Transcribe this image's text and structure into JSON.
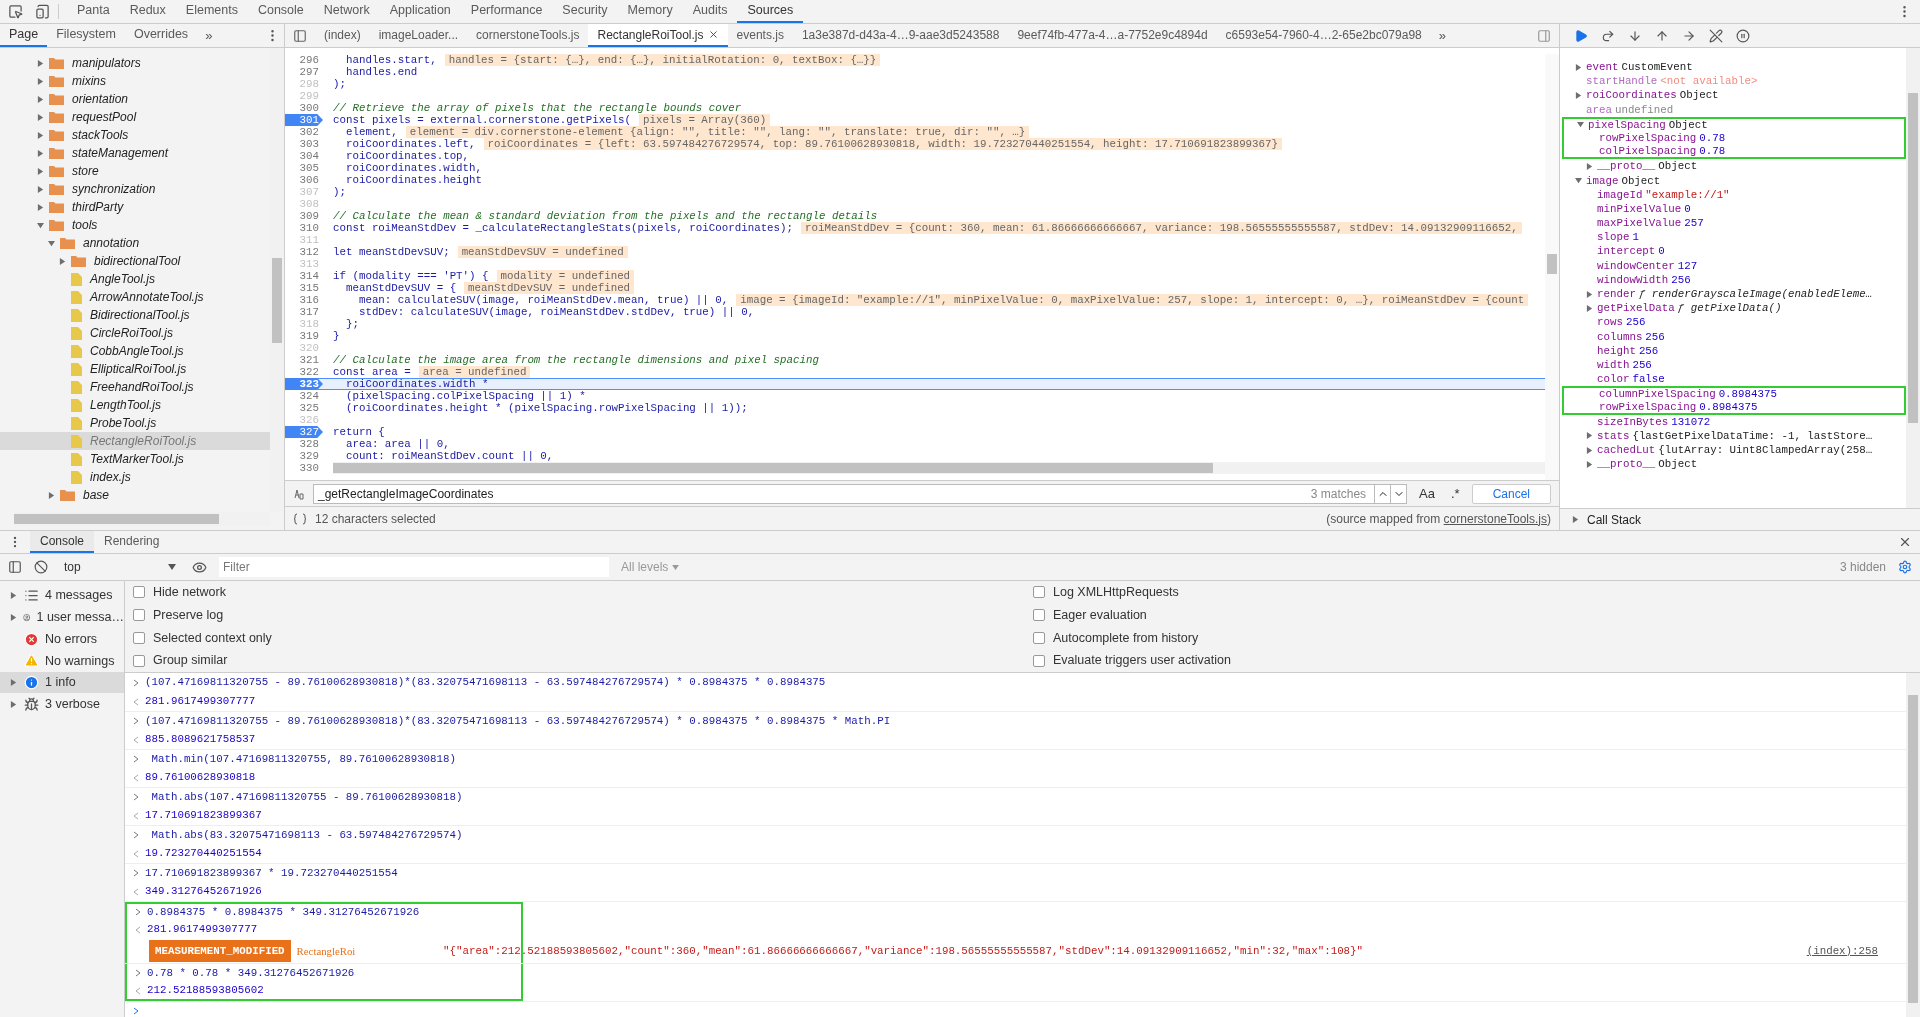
{
  "top_tabs": [
    {
      "label": "Panta",
      "selected": false
    },
    {
      "label": "Redux",
      "selected": false
    },
    {
      "label": "Elements",
      "selected": false
    },
    {
      "label": "Console",
      "selected": false
    },
    {
      "label": "Network",
      "selected": false
    },
    {
      "label": "Application",
      "selected": false
    },
    {
      "label": "Performance",
      "selected": false
    },
    {
      "label": "Security",
      "selected": false
    },
    {
      "label": "Memory",
      "selected": false
    },
    {
      "label": "Audits",
      "selected": false
    },
    {
      "label": "Sources",
      "selected": true
    }
  ],
  "navigator": {
    "tabs": [
      {
        "label": "Page",
        "selected": true
      },
      {
        "label": "Filesystem",
        "selected": false
      },
      {
        "label": "Overrides",
        "selected": false
      }
    ],
    "more": "»",
    "tree": [
      {
        "name": "manipulators",
        "kind": "folder",
        "expanded": false,
        "selected": false
      },
      {
        "name": "mixins",
        "kind": "folder",
        "expanded": false,
        "selected": false
      },
      {
        "name": "orientation",
        "kind": "folder",
        "expanded": false,
        "selected": false
      },
      {
        "name": "requestPool",
        "kind": "folder",
        "expanded": false,
        "selected": false
      },
      {
        "name": "stackTools",
        "kind": "folder",
        "expanded": false,
        "selected": false
      },
      {
        "name": "stateManagement",
        "kind": "folder",
        "expanded": false,
        "selected": false
      },
      {
        "name": "store",
        "kind": "folder",
        "expanded": false,
        "selected": false
      },
      {
        "name": "synchronization",
        "kind": "folder",
        "expanded": false,
        "selected": false
      },
      {
        "name": "thirdParty",
        "kind": "folder",
        "expanded": false,
        "selected": false
      },
      {
        "name": "tools",
        "kind": "folder",
        "expanded": true,
        "selected": false,
        "children": [
          {
            "name": "annotation",
            "kind": "folder",
            "expanded": true,
            "selected": false,
            "children": [
              {
                "name": "bidirectionalTool",
                "kind": "folder",
                "expanded": false,
                "selected": false
              },
              {
                "name": "AngleTool.js",
                "kind": "file",
                "selected": false
              },
              {
                "name": "ArrowAnnotateTool.js",
                "kind": "file",
                "selected": false
              },
              {
                "name": "BidirectionalTool.js",
                "kind": "file",
                "selected": false
              },
              {
                "name": "CircleRoiTool.js",
                "kind": "file",
                "selected": false
              },
              {
                "name": "CobbAngleTool.js",
                "kind": "file",
                "selected": false
              },
              {
                "name": "EllipticalRoiTool.js",
                "kind": "file",
                "selected": false
              },
              {
                "name": "FreehandRoiTool.js",
                "kind": "file",
                "selected": false
              },
              {
                "name": "LengthTool.js",
                "kind": "file",
                "selected": false
              },
              {
                "name": "ProbeTool.js",
                "kind": "file",
                "selected": false
              },
              {
                "name": "RectangleRoiTool.js",
                "kind": "file",
                "selected": true
              },
              {
                "name": "TextMarkerTool.js",
                "kind": "file",
                "selected": false
              },
              {
                "name": "index.js",
                "kind": "file",
                "selected": false
              }
            ]
          },
          {
            "name": "base",
            "kind": "folder",
            "expanded": false,
            "selected": false
          }
        ]
      }
    ]
  },
  "editor": {
    "tabs": [
      {
        "label": "(index)",
        "selected": false,
        "closable": false
      },
      {
        "label": "imageLoader...",
        "selected": false,
        "closable": false
      },
      {
        "label": "cornerstoneTools.js",
        "selected": false,
        "closable": false
      },
      {
        "label": "RectangleRoiTool.js",
        "selected": true,
        "closable": true
      },
      {
        "label": "events.js",
        "selected": false,
        "closable": false
      },
      {
        "label": "1a3e387d-d43a-4…9-aae3d5243588",
        "selected": false,
        "closable": false
      },
      {
        "label": "9eef74fb-477a-4…a-7752e9c4894d",
        "selected": false,
        "closable": false
      },
      {
        "label": "c6593e54-7960-4…2-65e2bc079a98",
        "selected": false,
        "closable": false
      }
    ],
    "more": "»",
    "lines": [
      {
        "number": "296",
        "kind": "code",
        "text": "  handles.start,",
        "inline_value": "handles = {start: {…}, end: {…}, initialRotation: 0, textBox: {…}}",
        "breakpoint": false,
        "current": false,
        "greyed": false
      },
      {
        "number": "297",
        "kind": "code",
        "text": "  handles.end",
        "breakpoint": false,
        "current": false,
        "greyed": false
      },
      {
        "number": "298",
        "kind": "code",
        "text": ");",
        "breakpoint": false,
        "current": false,
        "greyed": true
      },
      {
        "number": "299",
        "breakpoint": false,
        "current": false,
        "greyed": true
      },
      {
        "number": "300",
        "kind": "comment",
        "text": "// Retrieve the array of pixels that the rectangle bounds cover",
        "breakpoint": false,
        "current": false,
        "greyed": false
      },
      {
        "number": "301",
        "kind": "code",
        "text": "const pixels = external.cornerstone.getPixels(",
        "inline_value": "pixels = Array(360)",
        "breakpoint": true,
        "current": false,
        "greyed": false
      },
      {
        "number": "302",
        "kind": "code",
        "text": "  element,",
        "inline_value": "element = div.cornerstone-element {align: \"\", title: \"\", lang: \"\", translate: true, dir: \"\", …}",
        "breakpoint": false,
        "current": false,
        "greyed": false
      },
      {
        "number": "303",
        "kind": "code",
        "text": "  roiCoordinates.left,",
        "inline_value": "roiCoordinates = {left: 63.597484276729574, top: 89.76100628930818, width: 19.723270440251554, height: 17.710691823899367}",
        "breakpoint": false,
        "current": false,
        "greyed": false
      },
      {
        "number": "304",
        "kind": "code",
        "text": "  roiCoordinates.top,",
        "breakpoint": false,
        "current": false,
        "greyed": false
      },
      {
        "number": "305",
        "kind": "code",
        "text": "  roiCoordinates.width,",
        "breakpoint": false,
        "current": false,
        "greyed": false
      },
      {
        "number": "306",
        "kind": "code",
        "text": "  roiCoordinates.height",
        "breakpoint": false,
        "current": false,
        "greyed": false
      },
      {
        "number": "307",
        "kind": "code",
        "text": ");",
        "breakpoint": false,
        "current": false,
        "greyed": true
      },
      {
        "number": "308",
        "breakpoint": false,
        "current": false,
        "greyed": true
      },
      {
        "number": "309",
        "kind": "comment",
        "text": "// Calculate the mean & standard deviation from the pixels and the rectangle details",
        "breakpoint": false,
        "current": false,
        "greyed": false
      },
      {
        "number": "310",
        "kind": "code",
        "text": "const roiMeanStdDev = _calculateRectangleStats(pixels, roiCoordinates);",
        "inline_value": "roiMeanStdDev = {count: 360, mean: 61.86666666666667, variance: 198.56555555555587, stdDev: 14.09132909116652,",
        "breakpoint": false,
        "current": false,
        "greyed": false
      },
      {
        "number": "311",
        "breakpoint": false,
        "current": false,
        "greyed": true
      },
      {
        "number": "312",
        "kind": "code",
        "text": "let meanStdDevSUV;",
        "inline_value": "meanStdDevSUV = undefined",
        "breakpoint": false,
        "current": false,
        "greyed": false
      },
      {
        "number": "313",
        "breakpoint": false,
        "current": false,
        "greyed": true
      },
      {
        "number": "314",
        "kind": "code",
        "text": "if (modality === 'PT') {",
        "inline_value": "modality = undefined",
        "breakpoint": false,
        "current": false,
        "greyed": false
      },
      {
        "number": "315",
        "kind": "code",
        "text": "  meanStdDevSUV = {",
        "inline_value": "meanStdDevSUV = undefined",
        "breakpoint": false,
        "current": false,
        "greyed": false
      },
      {
        "number": "316",
        "kind": "code",
        "text": "    mean: calculateSUV(image, roiMeanStdDev.mean, true) || 0,",
        "inline_value": "image = {imageId: \"example://1\", minPixelValue: 0, maxPixelValue: 257, slope: 1, intercept: 0, …}, roiMeanStdDev = {count",
        "breakpoint": false,
        "current": false,
        "greyed": false
      },
      {
        "number": "317",
        "kind": "code",
        "text": "    stdDev: calculateSUV(image, roiMeanStdDev.stdDev, true) || 0,",
        "breakpoint": false,
        "current": false,
        "greyed": false
      },
      {
        "number": "318",
        "kind": "code",
        "text": "  };",
        "breakpoint": false,
        "current": false,
        "greyed": true
      },
      {
        "number": "319",
        "kind": "code",
        "text": "}",
        "breakpoint": false,
        "current": false,
        "greyed": false
      },
      {
        "number": "320",
        "breakpoint": false,
        "current": false,
        "greyed": true
      },
      {
        "number": "321",
        "kind": "comment",
        "text": "// Calculate the image area from the rectangle dimensions and pixel spacing",
        "breakpoint": false,
        "current": false,
        "greyed": false
      },
      {
        "number": "322",
        "kind": "code",
        "text": "const area =",
        "inline_value": "area = undefined",
        "breakpoint": false,
        "current": false,
        "greyed": false
      },
      {
        "number": "323",
        "kind": "code",
        "text": "  roiCoordinates.width *",
        "breakpoint": true,
        "current": true,
        "greyed": false
      },
      {
        "number": "324",
        "kind": "code",
        "text": "  (pixelSpacing.colPixelSpacing || 1) *",
        "breakpoint": false,
        "current": false,
        "greyed": false
      },
      {
        "number": "325",
        "kind": "code",
        "text": "  (roiCoordinates.height * (pixelSpacing.rowPixelSpacing || 1));",
        "breakpoint": false,
        "current": false,
        "greyed": false
      },
      {
        "number": "326",
        "breakpoint": false,
        "current": false,
        "greyed": true
      },
      {
        "number": "327",
        "kind": "code",
        "text": "return {",
        "breakpoint": true,
        "current": false,
        "greyed": false
      },
      {
        "number": "328",
        "kind": "code",
        "text": "  area: area || 0,",
        "breakpoint": false,
        "current": false,
        "greyed": false
      },
      {
        "number": "329",
        "kind": "code",
        "text": "  count: roiMeanStdDev.count || 0,",
        "breakpoint": false,
        "current": false,
        "greyed": false
      },
      {
        "number": "330",
        "breakpoint": false,
        "current": false,
        "greyed": false
      }
    ],
    "search": {
      "value": "_getRectangleImageCoordinates",
      "matches": "3 matches",
      "case_button": "Aa",
      "regex_button": ".*",
      "cancel": "Cancel"
    },
    "status": {
      "selection": "12 characters selected",
      "source_prefix": "(source mapped from ",
      "source_link": "cornerstoneTools.js",
      "source_suffix": ")"
    }
  },
  "scope": [
    {
      "key": "event",
      "value": "CustomEvent",
      "expanded": false,
      "kind": "object",
      "marked": false
    },
    {
      "key": "startHandle",
      "value": "<not available>",
      "kind": "unavailable",
      "marked": false
    },
    {
      "key": "roiCoordinates",
      "value": "Object",
      "expanded": false,
      "kind": "object",
      "marked": false
    },
    {
      "key": "area",
      "value": "undefined",
      "kind": "undefined",
      "marked": false
    },
    {
      "key": "pixelSpacing",
      "value": "Object",
      "expanded": true,
      "kind": "object",
      "marked": true,
      "children": [
        {
          "key": "rowPixelSpacing",
          "value": "0.78",
          "kind": "number",
          "marked": true
        },
        {
          "key": "colPixelSpacing",
          "value": "0.78",
          "kind": "number",
          "marked": true
        },
        {
          "key": "__proto__",
          "value": "Object",
          "expanded": false,
          "kind": "object",
          "marked": false
        }
      ]
    },
    {
      "key": "image",
      "value": "Object",
      "expanded": true,
      "kind": "object",
      "marked": false,
      "children": [
        {
          "key": "imageId",
          "value": "\"example://1\"",
          "kind": "string",
          "marked": false
        },
        {
          "key": "minPixelValue",
          "value": "0",
          "kind": "number",
          "marked": false
        },
        {
          "key": "maxPixelValue",
          "value": "257",
          "kind": "number",
          "marked": false
        },
        {
          "key": "slope",
          "value": "1",
          "kind": "number",
          "marked": false
        },
        {
          "key": "intercept",
          "value": "0",
          "kind": "number",
          "marked": false
        },
        {
          "key": "windowCenter",
          "value": "127",
          "kind": "number",
          "marked": false
        },
        {
          "key": "windowWidth",
          "value": "256",
          "kind": "number",
          "marked": false
        },
        {
          "key": "render",
          "value": "ƒ renderGrayscaleImage(enabledEleme…",
          "expanded": false,
          "kind": "function",
          "marked": false
        },
        {
          "key": "getPixelData",
          "value": "ƒ getPixelData()",
          "expanded": false,
          "kind": "function",
          "marked": false
        },
        {
          "key": "rows",
          "value": "256",
          "kind": "number",
          "marked": false
        },
        {
          "key": "columns",
          "value": "256",
          "kind": "number",
          "marked": false
        },
        {
          "key": "height",
          "value": "256",
          "kind": "number",
          "marked": false
        },
        {
          "key": "width",
          "value": "256",
          "kind": "number",
          "marked": false
        },
        {
          "key": "color",
          "value": "false",
          "kind": "number",
          "marked": false
        },
        {
          "key": "columnPixelSpacing",
          "value": "0.8984375",
          "kind": "number",
          "marked": true
        },
        {
          "key": "rowPixelSpacing",
          "value": "0.8984375",
          "kind": "number",
          "marked": true
        },
        {
          "key": "sizeInBytes",
          "value": "131072",
          "kind": "number",
          "marked": false
        },
        {
          "key": "stats",
          "value": "{lastGetPixelDataTime: -1, lastStore…",
          "expanded": false,
          "kind": "object",
          "marked": false
        },
        {
          "key": "cachedLut",
          "value": "{lutArray: Uint8ClampedArray(258…",
          "expanded": false,
          "kind": "object",
          "marked": false
        },
        {
          "key": "__proto__",
          "value": "Object",
          "expanded": false,
          "kind": "object",
          "marked": false
        }
      ]
    }
  ],
  "call_stack": {
    "label": "Call Stack",
    "expanded": false
  },
  "drawer": {
    "tabs": [
      {
        "label": "Console",
        "selected": true
      },
      {
        "label": "Rendering",
        "selected": false
      }
    ],
    "context": "top",
    "filter_placeholder": "Filter",
    "levels": "All levels",
    "hidden": "3 hidden",
    "sidebar": [
      {
        "label": "4 messages",
        "kind": "list",
        "expandable": true,
        "selected": false
      },
      {
        "label": "1 user messa…",
        "kind": "user",
        "expandable": true,
        "selected": false
      },
      {
        "label": "No errors",
        "kind": "error",
        "expandable": false,
        "selected": false
      },
      {
        "label": "No warnings",
        "kind": "warning",
        "expandable": false,
        "selected": false
      },
      {
        "label": "1 info",
        "kind": "info",
        "expandable": true,
        "selected": true
      },
      {
        "label": "3 verbose",
        "kind": "verbose",
        "expandable": true,
        "selected": false
      }
    ],
    "settings_left": [
      {
        "label": "Hide network",
        "checked": false
      },
      {
        "label": "Preserve log",
        "checked": false
      },
      {
        "label": "Selected context only",
        "checked": false
      },
      {
        "label": "Group similar",
        "checked": false
      }
    ],
    "settings_right": [
      {
        "label": "Log XMLHttpRequests",
        "checked": false
      },
      {
        "label": "Eager evaluation",
        "checked": false
      },
      {
        "label": "Autocomplete from history",
        "checked": false
      },
      {
        "label": "Evaluate triggers user activation",
        "checked": false
      }
    ],
    "messages": [
      {
        "kind": "input",
        "text": "(107.47169811320755 - 89.76100628930818)*(83.32075471698113 - 63.597484276729574) * 0.8984375 * 0.8984375",
        "marked": false
      },
      {
        "kind": "output",
        "text": "281.9617499307777",
        "marked": false
      },
      {
        "kind": "input",
        "text": "(107.47169811320755 - 89.76100628930818)*(83.32075471698113 - 63.597484276729574) * 0.8984375 * 0.8984375 * Math.PI",
        "marked": false
      },
      {
        "kind": "output",
        "text": "885.8089621758537",
        "marked": false
      },
      {
        "kind": "input",
        "text": " Math.min(107.47169811320755, 89.76100628930818)",
        "marked": false
      },
      {
        "kind": "output",
        "text": "89.76100628930818",
        "marked": false
      },
      {
        "kind": "input",
        "text": " Math.abs(107.47169811320755 - 89.76100628930818)",
        "marked": false
      },
      {
        "kind": "output",
        "text": "17.710691823899367",
        "marked": false
      },
      {
        "kind": "input",
        "text": " Math.abs(83.32075471698113 - 63.597484276729574)",
        "marked": false
      },
      {
        "kind": "output",
        "text": "19.723270440251554",
        "marked": false
      },
      {
        "kind": "input",
        "text": "17.710691823899367 * 19.723270440251554",
        "marked": false
      },
      {
        "kind": "output",
        "text": "349.31276452671926",
        "marked": false
      },
      {
        "kind": "input",
        "text": "0.8984375 * 0.8984375 * 349.31276452671926",
        "marked": true
      },
      {
        "kind": "output",
        "text": "281.9617499307777",
        "marked": true
      },
      {
        "kind": "log",
        "badge": "MEASUREMENT_MODIFIED",
        "tag": "RectangleRoi",
        "text": "\"{\"area\":212.52188593805602,\"count\":360,\"mean\":61.86666666666667,\"variance\":198.56555555555587,\"stdDev\":14.09132909116652,\"min\":32,\"max\":108}\"",
        "source": "(index):258",
        "marked": true
      },
      {
        "kind": "input",
        "text": "0.78 * 0.78 * 349.31276452671926",
        "marked": true
      },
      {
        "kind": "output",
        "text": "212.52188593805602",
        "marked": true
      }
    ]
  }
}
